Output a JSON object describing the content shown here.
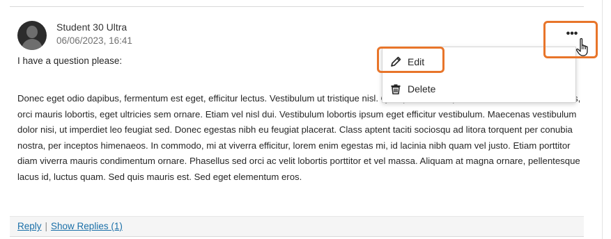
{
  "post": {
    "author": "Student 30 Ultra",
    "date": "06/06/2023, 16:41",
    "question": "I have a question please:",
    "body": "Donec eget odio dapibus, fermentum est eget, efficitur lectus. Vestibulum ut tristique nisl. Quisque ullamcorper, mauris vel laoreet rhoncus, orci mauris lobortis, eget ultricies sem ornare. Etiam vel nisl dui. Vestibulum lobortis ipsum eget efficitur vestibulum. Maecenas vestibulum dolor nisi, ut imperdiet leo feugiat sed. Donec egestas nibh eu feugiat placerat. Class aptent taciti sociosqu ad litora torquent per conubia nostra, per inceptos himenaeos. In commodo, mi at viverra efficitur, lorem enim egestas mi, id lacinia nibh quam vel justo. Etiam porttitor diam viverra mauris condimentum ornare. Phasellus sed orci ac velit lobortis porttitor et vel massa. Aliquam at magna ornare, pellentesque lacus id, luctus quam. Sed quis mauris est. Sed eget elementum eros."
  },
  "footer": {
    "reply": "Reply",
    "separator": "|",
    "show_replies": "Show Replies (1)"
  },
  "more_button": {
    "label": "•••"
  },
  "menu": {
    "items": [
      {
        "label": "Edit",
        "icon": "pencil-icon"
      },
      {
        "label": "Delete",
        "icon": "trash-icon"
      }
    ]
  },
  "colors": {
    "highlight": "#e8752a",
    "link": "#1a6fa8"
  }
}
